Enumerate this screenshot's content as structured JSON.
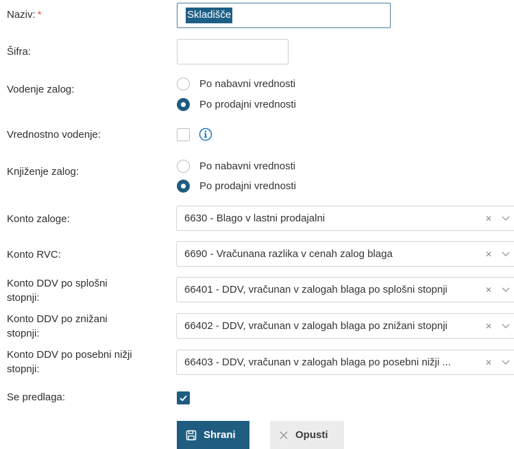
{
  "form": {
    "naziv": {
      "label": "Naziv:",
      "required_mark": "*",
      "value": "Skladišče"
    },
    "sifra": {
      "label": "Šifra:",
      "value": ""
    },
    "vodenje_zalog": {
      "label": "Vodenje zalog:",
      "options": [
        "Po nabavni vrednosti",
        "Po prodajni vrednosti"
      ],
      "selected": "Po prodajni vrednosti"
    },
    "vrednostno_vodenje": {
      "label": "Vrednostno vodenje:",
      "checked": false,
      "icon": "info-icon"
    },
    "knjizenje_zalog": {
      "label": "Knjiženje zalog:",
      "options": [
        "Po nabavni vrednosti",
        "Po prodajni vrednosti"
      ],
      "selected": "Po prodajni vrednosti"
    },
    "konto_zaloge": {
      "label": "Konto zaloge:",
      "value": "6630 - Blago v lastni prodajalni"
    },
    "konto_rvc": {
      "label": "Konto RVC:",
      "value": "6690 - Vračunana razlika v cenah zalog blaga"
    },
    "konto_ddv_splosni": {
      "label_line1": "Konto DDV po splošni",
      "label_line2": "stopnji:",
      "value": "66401 - DDV, vračunan v zalogah blaga po splošni stopnji"
    },
    "konto_ddv_znizani": {
      "label_line1": "Konto DDV po znižani",
      "label_line2": "stopnji:",
      "value": "66402 - DDV, vračunan v zalogah blaga po znižani stopnji"
    },
    "konto_ddv_posebni": {
      "label_line1": "Konto DDV po posebni nižji",
      "label_line2": "stopnji:",
      "value": "66403 - DDV, vračunan v zalogah blaga po posebni nižji ..."
    },
    "se_predlaga": {
      "label": "Se predlaga:",
      "checked": true
    }
  },
  "buttons": {
    "save_label": "Shrani",
    "cancel_label": "Opusti"
  },
  "colors": {
    "accent": "#1f5d80",
    "required": "#d9534f",
    "cancel_bg": "#ececec"
  }
}
